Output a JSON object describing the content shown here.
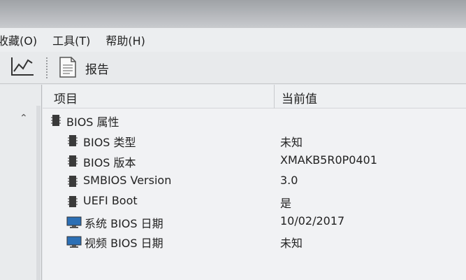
{
  "menubar": {
    "items": [
      "收藏(O)",
      "工具(T)",
      "帮助(H)"
    ]
  },
  "toolbar": {
    "report_label": "报告",
    "chart_icon": "line-chart-icon",
    "report_icon": "document-icon"
  },
  "table": {
    "col_item": "项目",
    "col_value": "当前值",
    "group": "BIOS 属性",
    "rows": [
      {
        "label": "BIOS 类型",
        "value": "未知",
        "icon": "chip-icon"
      },
      {
        "label": "BIOS 版本",
        "value": "XMAKB5R0P0401",
        "icon": "chip-icon"
      },
      {
        "label": "SMBIOS Version",
        "value": "3.0",
        "icon": "chip-icon"
      },
      {
        "label": "UEFI Boot",
        "value": "是",
        "icon": "chip-icon"
      },
      {
        "label": "系统 BIOS 日期",
        "value": "10/02/2017",
        "icon": "monitor-icon"
      },
      {
        "label": "视频 BIOS 日期",
        "value": "未知",
        "icon": "monitor-icon"
      }
    ]
  },
  "colors": {
    "accent": "#2b6fb5"
  }
}
